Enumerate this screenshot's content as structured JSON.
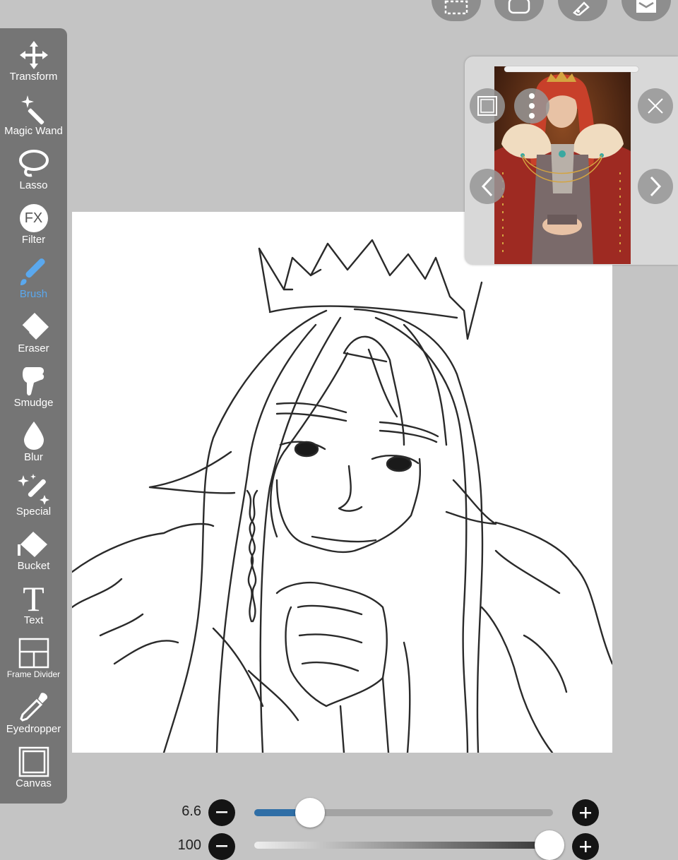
{
  "app": {
    "accent": "#5aa8ee",
    "panel_color": "#757575",
    "background": "#c4c4c4"
  },
  "top_toolbar": [
    {
      "name": "selection-icon"
    },
    {
      "name": "layer-icon"
    },
    {
      "name": "pen-icon"
    },
    {
      "name": "layers-panel-icon"
    }
  ],
  "tools": [
    {
      "label": "Transform",
      "icon": "move-arrows-icon",
      "active": false
    },
    {
      "label": "Magic Wand",
      "icon": "magic-wand-icon",
      "active": false
    },
    {
      "label": "Lasso",
      "icon": "lasso-icon",
      "active": false
    },
    {
      "label": "Filter",
      "icon": "fx-icon",
      "icon_text": "FX",
      "active": false
    },
    {
      "label": "Brush",
      "icon": "brush-icon",
      "active": true
    },
    {
      "label": "Eraser",
      "icon": "eraser-icon",
      "active": false
    },
    {
      "label": "Smudge",
      "icon": "smudge-icon",
      "active": false
    },
    {
      "label": "Blur",
      "icon": "drop-icon",
      "active": false
    },
    {
      "label": "Special",
      "icon": "sparkle-brush-icon",
      "active": false
    },
    {
      "label": "Bucket",
      "icon": "bucket-icon",
      "active": false
    },
    {
      "label": "Text",
      "icon": "text-icon",
      "icon_text": "T",
      "active": false
    },
    {
      "label": "Frame Divider",
      "icon": "frame-divider-icon",
      "active": false
    },
    {
      "label": "Eyedropper",
      "icon": "eyedropper-icon",
      "active": false
    },
    {
      "label": "Canvas",
      "icon": "canvas-icon",
      "active": false
    }
  ],
  "reference_window": {
    "buttons": [
      "square-icon",
      "more-vertical-icon",
      "close-icon",
      "chevron-left-icon",
      "chevron-right-icon"
    ]
  },
  "brush_size": {
    "value": "6.6",
    "level_fraction": 0.07
  },
  "brush_opacity": {
    "value": "100",
    "level_fraction": 1.0
  }
}
